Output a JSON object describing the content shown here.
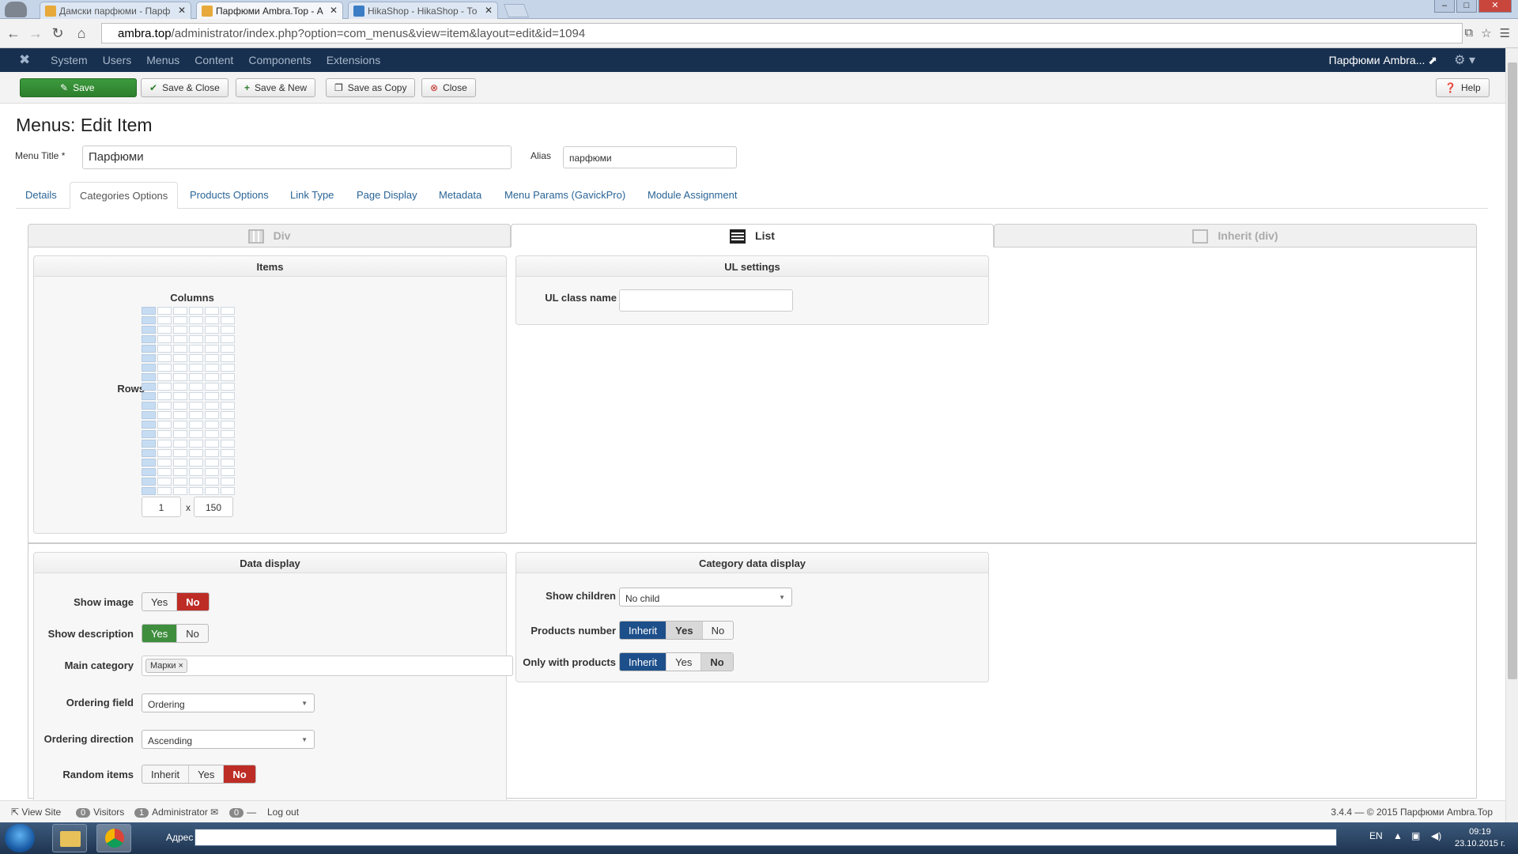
{
  "browser": {
    "tabs": [
      {
        "label": "Дамски парфюми - Парф",
        "active": false
      },
      {
        "label": "Парфюми Ambra.Top - А",
        "active": true
      },
      {
        "label": "HikaShop - HikaShop - То",
        "active": false
      }
    ],
    "url_host": "ambra.top",
    "url_path": "/administrator/index.php?option=com_menus&view=item&layout=edit&id=1094"
  },
  "nav": {
    "items": [
      "System",
      "Users",
      "Menus",
      "Content",
      "Components",
      "Extensions"
    ],
    "site_name": "Парфюми Ambra...",
    "external_glyph": "⬈"
  },
  "toolbar": {
    "save": "Save",
    "save_close": "Save & Close",
    "save_new": "Save & New",
    "save_copy": "Save as Copy",
    "close": "Close",
    "help": "Help"
  },
  "page": {
    "title": "Menus: Edit Item",
    "menu_title_label": "Menu Title *",
    "menu_title_value": "Парфюми",
    "alias_label": "Alias",
    "alias_value": "парфюми"
  },
  "tabs": [
    "Details",
    "Categories Options",
    "Products Options",
    "Link Type",
    "Page Display",
    "Metadata",
    "Menu Params (GavickPro)",
    "Module Assignment"
  ],
  "layout_tabs": [
    {
      "label": "Div",
      "active": false
    },
    {
      "label": "List",
      "active": true
    },
    {
      "label": "Inherit (div)",
      "active": false
    }
  ],
  "items_panel": {
    "title": "Items",
    "columns_label": "Columns",
    "rows_label": "Rows",
    "columns_value": "1",
    "x_label": "x",
    "rows_value": "150"
  },
  "ul_panel": {
    "title": "UL settings",
    "class_label": "UL class name",
    "class_value": ""
  },
  "data_display": {
    "title": "Data display",
    "show_image_label": "Show image",
    "show_image": {
      "yes": "Yes",
      "no": "No",
      "selected": "No"
    },
    "show_description_label": "Show description",
    "show_description": {
      "yes": "Yes",
      "no": "No",
      "selected": "Yes"
    },
    "main_category_label": "Main category",
    "main_category_tag": "Марки",
    "remove_glyph": "×",
    "ordering_field_label": "Ordering field",
    "ordering_field_value": "Ordering",
    "ordering_direction_label": "Ordering direction",
    "ordering_direction_value": "Ascending",
    "random_items_label": "Random items",
    "random_items": {
      "inherit": "Inherit",
      "yes": "Yes",
      "no": "No",
      "selected": "No"
    }
  },
  "category_display": {
    "title": "Category data display",
    "show_children_label": "Show children",
    "show_children_value": "No child",
    "products_number_label": "Products number",
    "products_number": {
      "inherit": "Inherit",
      "yes": "Yes",
      "no": "No",
      "selected": "Inherit"
    },
    "only_with_products_label": "Only with products",
    "only_with_products": {
      "inherit": "Inherit",
      "yes": "Yes",
      "no": "No",
      "selected": "Inherit"
    }
  },
  "status": {
    "view_site": "View Site",
    "visitors_count": "0",
    "visitors": "Visitors",
    "admin_count": "1",
    "administrator": "Administrator",
    "messages_count": "0",
    "logout": "Log out",
    "version": "3.4.4 — © 2015 Парфюми Ambra.Top"
  },
  "taskbar": {
    "address_label": "Адрес",
    "lang": "EN",
    "time": "09:19",
    "date": "23.10.2015 г."
  },
  "colors": {
    "nav_bg": "#17304f",
    "save_green": "#2d7f2d",
    "link_blue": "#2a6496",
    "no_red": "#bd2d26",
    "inherit_blue": "#1d4f8a"
  }
}
